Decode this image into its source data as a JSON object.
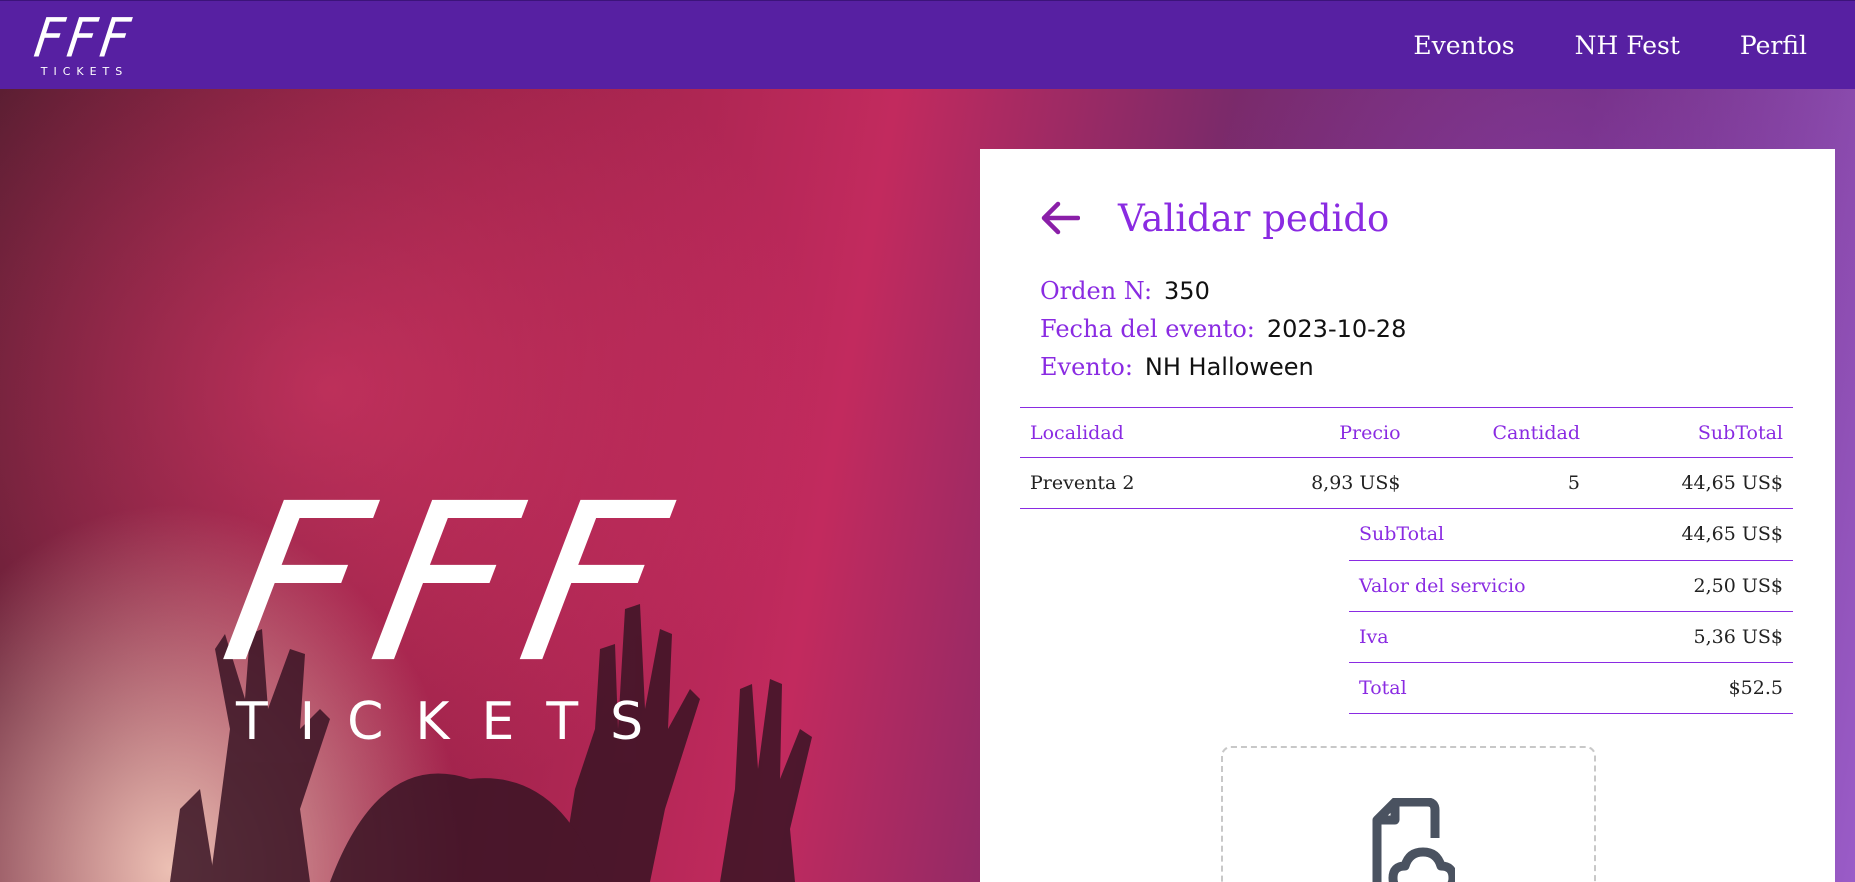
{
  "brand": {
    "logo_main": "FFF",
    "logo_sub": "TICKETS"
  },
  "nav": {
    "links": [
      "Eventos",
      "NH Fest",
      "Perfil"
    ]
  },
  "hero": {
    "logo_main": "FFF",
    "logo_sub": "TICKETS"
  },
  "order": {
    "title": "Validar pedido",
    "order_number_label": "Orden N:",
    "order_number": "350",
    "event_date_label": "Fecha del evento:",
    "event_date": "2023-10-28",
    "event_label": "Evento:",
    "event_name": "NH Halloween",
    "table": {
      "headers": [
        "Localidad",
        "Precio",
        "Cantidad",
        "SubTotal"
      ],
      "rows": [
        {
          "localidad": "Preventa 2",
          "precio": "8,93 US$",
          "cantidad": "5",
          "subtotal": "44,65 US$"
        }
      ]
    },
    "totals": [
      {
        "label": "SubTotal",
        "value": "44,65 US$"
      },
      {
        "label": "Valor del servicio",
        "value": "2,50 US$"
      },
      {
        "label": "Iva",
        "value": "5,36 US$"
      },
      {
        "label": "Total",
        "value": "$52.5"
      }
    ]
  },
  "colors": {
    "navbar": "#5720a2",
    "accent": "#8a2be2",
    "upload_icon": "#4a5260"
  },
  "icons": {
    "back": "arrow-left-icon",
    "upload": "file-cloud-upload-icon"
  }
}
